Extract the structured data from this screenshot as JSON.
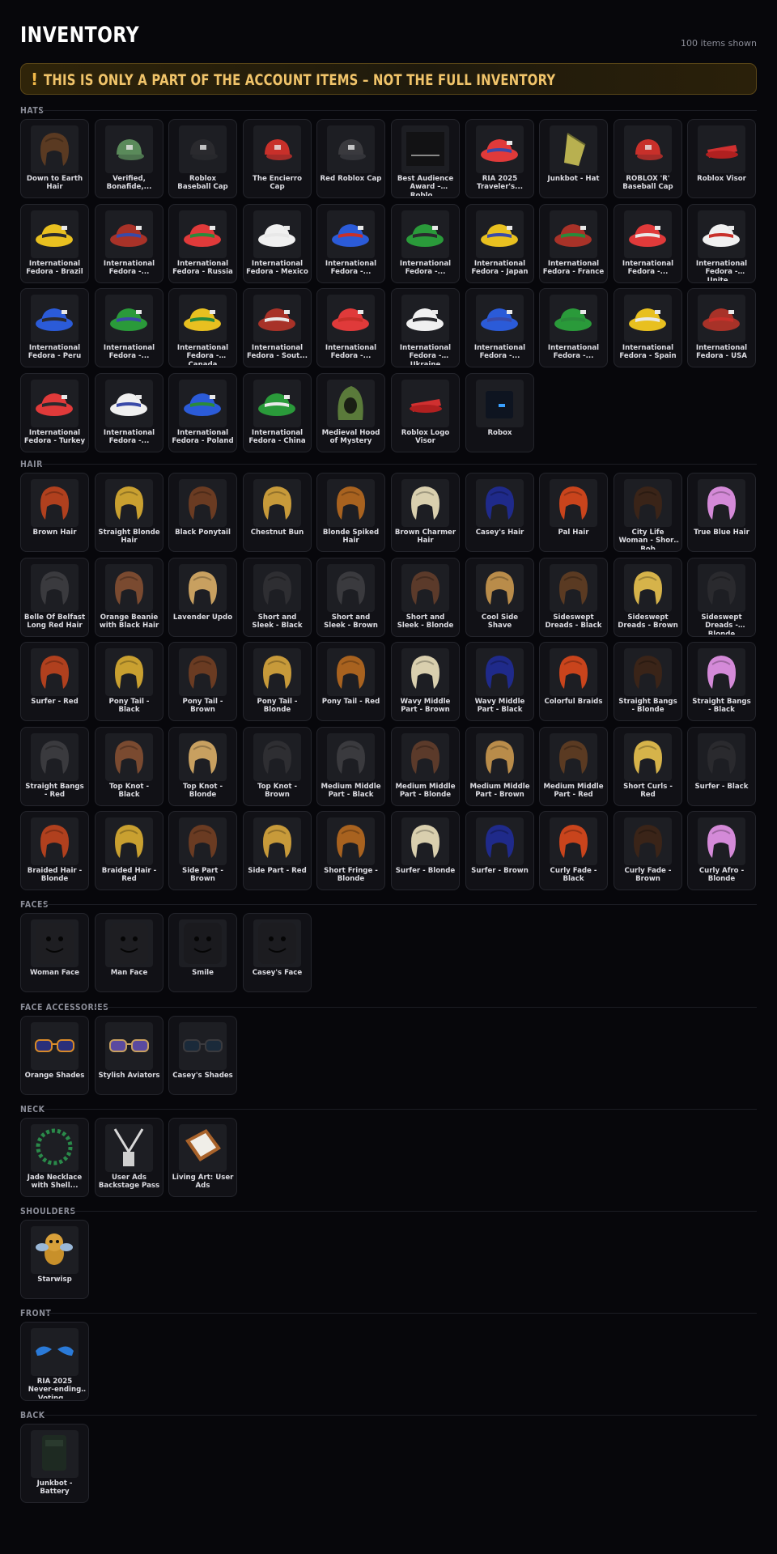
{
  "page": {
    "title": "INVENTORY",
    "count": "100 items shown"
  },
  "warning": {
    "icon": "!",
    "text": "THIS IS ONLY A PART OF THE ACCOUNT ITEMS – NOT THE FULL INVENTORY"
  },
  "colors": {
    "accent": "#f1c46a",
    "background": "#07070b",
    "card": "#111116"
  },
  "sections": [
    {
      "name": "HATS",
      "items": [
        {
          "label": "Down to Earth Hair",
          "icon": "hair-icon"
        },
        {
          "label": "Verified, Bonafide,...",
          "icon": "cap-icon"
        },
        {
          "label": "Roblox Baseball Cap",
          "icon": "cap-icon"
        },
        {
          "label": "The Encierro Cap",
          "icon": "cap-icon"
        },
        {
          "label": "Red Roblox Cap",
          "icon": "cap-icon"
        },
        {
          "label": "Best Audience Award – Roblo...",
          "icon": "award-icon"
        },
        {
          "label": "RIA 2025 Traveler's...",
          "icon": "fedora-icon"
        },
        {
          "label": "Junkbot - Hat",
          "icon": "hat-icon"
        },
        {
          "label": "ROBLOX 'R' Baseball Cap",
          "icon": "cap-icon"
        },
        {
          "label": "Roblox Visor",
          "icon": "visor-icon"
        },
        {
          "label": "International Fedora - Brazil",
          "icon": "fedora-icon"
        },
        {
          "label": "International Fedora -...",
          "icon": "fedora-icon"
        },
        {
          "label": "International Fedora - Russia",
          "icon": "fedora-icon"
        },
        {
          "label": "International Fedora - Mexico",
          "icon": "fedora-icon"
        },
        {
          "label": "International Fedora -...",
          "icon": "fedora-icon"
        },
        {
          "label": "International Fedora -...",
          "icon": "fedora-icon"
        },
        {
          "label": "International Fedora - Japan",
          "icon": "fedora-icon"
        },
        {
          "label": "International Fedora - France",
          "icon": "fedora-icon"
        },
        {
          "label": "International Fedora -...",
          "icon": "fedora-icon"
        },
        {
          "label": "International Fedora - Unite...",
          "icon": "fedora-icon"
        },
        {
          "label": "International Fedora - Peru",
          "icon": "fedora-icon"
        },
        {
          "label": "International Fedora -...",
          "icon": "fedora-icon"
        },
        {
          "label": "International Fedora - Canada",
          "icon": "fedora-icon"
        },
        {
          "label": "International Fedora - Sout...",
          "icon": "fedora-icon"
        },
        {
          "label": "International Fedora -...",
          "icon": "fedora-icon"
        },
        {
          "label": "International Fedora - Ukraine",
          "icon": "fedora-icon"
        },
        {
          "label": "International Fedora -...",
          "icon": "fedora-icon"
        },
        {
          "label": "International Fedora -...",
          "icon": "fedora-icon"
        },
        {
          "label": "International Fedora - Spain",
          "icon": "fedora-icon"
        },
        {
          "label": "International Fedora - USA",
          "icon": "fedora-icon"
        },
        {
          "label": "International Fedora - Turkey",
          "icon": "fedora-icon"
        },
        {
          "label": "International Fedora -...",
          "icon": "fedora-icon"
        },
        {
          "label": "International Fedora - Poland",
          "icon": "fedora-icon"
        },
        {
          "label": "International Fedora - China",
          "icon": "fedora-icon"
        },
        {
          "label": "Medieval Hood of Mystery",
          "icon": "hood-icon"
        },
        {
          "label": "Roblox Logo Visor",
          "icon": "visor-icon"
        },
        {
          "label": "Robox",
          "icon": "box-icon"
        }
      ]
    },
    {
      "name": "HAIR",
      "items": [
        {
          "label": "Brown Hair",
          "icon": "hair-icon"
        },
        {
          "label": "Straight Blonde Hair",
          "icon": "hair-icon"
        },
        {
          "label": "Black Ponytail",
          "icon": "hair-icon"
        },
        {
          "label": "Chestnut Bun",
          "icon": "hair-icon"
        },
        {
          "label": "Blonde Spiked Hair",
          "icon": "hair-icon"
        },
        {
          "label": "Brown Charmer Hair",
          "icon": "hair-icon"
        },
        {
          "label": "Casey's Hair",
          "icon": "hair-icon"
        },
        {
          "label": "Pal Hair",
          "icon": "hair-icon"
        },
        {
          "label": "City Life Woman - Short Bob",
          "icon": "hair-icon"
        },
        {
          "label": "True Blue Hair",
          "icon": "hair-icon"
        },
        {
          "label": "Belle Of Belfast Long Red Hair",
          "icon": "hair-icon"
        },
        {
          "label": "Orange Beanie with Black Hair",
          "icon": "hair-icon"
        },
        {
          "label": "Lavender Updo",
          "icon": "hair-icon"
        },
        {
          "label": "Short and Sleek - Black",
          "icon": "hair-icon"
        },
        {
          "label": "Short and Sleek - Brown",
          "icon": "hair-icon"
        },
        {
          "label": "Short and Sleek - Blonde",
          "icon": "hair-icon"
        },
        {
          "label": "Cool Side Shave",
          "icon": "hair-icon"
        },
        {
          "label": "Sideswept Dreads - Black",
          "icon": "hair-icon"
        },
        {
          "label": "Sideswept Dreads - Brown",
          "icon": "hair-icon"
        },
        {
          "label": "Sideswept Dreads - Blonde",
          "icon": "hair-icon"
        },
        {
          "label": "Surfer - Red",
          "icon": "hair-icon"
        },
        {
          "label": "Pony Tail - Black",
          "icon": "hair-icon"
        },
        {
          "label": "Pony Tail - Brown",
          "icon": "hair-icon"
        },
        {
          "label": "Pony Tail - Blonde",
          "icon": "hair-icon"
        },
        {
          "label": "Pony Tail - Red",
          "icon": "hair-icon"
        },
        {
          "label": "Wavy Middle Part - Brown",
          "icon": "hair-icon"
        },
        {
          "label": "Wavy Middle Part - Black",
          "icon": "hair-icon"
        },
        {
          "label": "Colorful Braids",
          "icon": "hair-icon"
        },
        {
          "label": "Straight Bangs - Blonde",
          "icon": "hair-icon"
        },
        {
          "label": "Straight Bangs - Black",
          "icon": "hair-icon"
        },
        {
          "label": "Straight Bangs - Red",
          "icon": "hair-icon"
        },
        {
          "label": "Top Knot - Black",
          "icon": "hair-icon"
        },
        {
          "label": "Top Knot - Blonde",
          "icon": "hair-icon"
        },
        {
          "label": "Top Knot - Brown",
          "icon": "hair-icon"
        },
        {
          "label": "Medium Middle Part - Black",
          "icon": "hair-icon"
        },
        {
          "label": "Medium Middle Part - Blonde",
          "icon": "hair-icon"
        },
        {
          "label": "Medium Middle Part - Brown",
          "icon": "hair-icon"
        },
        {
          "label": "Medium Middle Part - Red",
          "icon": "hair-icon"
        },
        {
          "label": "Short Curls - Red",
          "icon": "hair-icon"
        },
        {
          "label": "Surfer - Black",
          "icon": "hair-icon"
        },
        {
          "label": "Braided Hair - Blonde",
          "icon": "hair-icon"
        },
        {
          "label": "Braided Hair - Red",
          "icon": "hair-icon"
        },
        {
          "label": "Side Part - Brown",
          "icon": "hair-icon"
        },
        {
          "label": "Side Part - Red",
          "icon": "hair-icon"
        },
        {
          "label": "Short Fringe - Blonde",
          "icon": "hair-icon"
        },
        {
          "label": "Surfer - Blonde",
          "icon": "hair-icon"
        },
        {
          "label": "Surfer - Brown",
          "icon": "hair-icon"
        },
        {
          "label": "Curly Fade - Black",
          "icon": "hair-icon"
        },
        {
          "label": "Curly Fade - Brown",
          "icon": "hair-icon"
        },
        {
          "label": "Curly Afro - Blonde",
          "icon": "hair-icon"
        }
      ]
    },
    {
      "name": "FACES",
      "items": [
        {
          "label": "Woman Face",
          "icon": "face-icon"
        },
        {
          "label": "Man Face",
          "icon": "face-icon"
        },
        {
          "label": "Smile",
          "icon": "face-icon"
        },
        {
          "label": "Casey's Face",
          "icon": "face-icon"
        }
      ]
    },
    {
      "name": "FACE ACCESSORIES",
      "items": [
        {
          "label": "Orange Shades",
          "icon": "sunglasses-icon"
        },
        {
          "label": "Stylish Aviators",
          "icon": "sunglasses-icon"
        },
        {
          "label": "Casey's Shades",
          "icon": "sunglasses-icon"
        }
      ]
    },
    {
      "name": "NECK",
      "items": [
        {
          "label": "Jade Necklace with Shell...",
          "icon": "necklace-icon"
        },
        {
          "label": "User Ads Backstage Pass",
          "icon": "lanyard-icon"
        },
        {
          "label": "Living Art: User Ads",
          "icon": "frame-icon"
        }
      ]
    },
    {
      "name": "SHOULDERS",
      "items": [
        {
          "label": "Starwisp",
          "icon": "creature-icon"
        }
      ]
    },
    {
      "name": "FRONT",
      "items": [
        {
          "label": "RIA 2025 Never-ending Voting...",
          "icon": "wings-icon"
        }
      ]
    },
    {
      "name": "BACK",
      "items": [
        {
          "label": "Junkbot - Battery",
          "icon": "battery-icon"
        }
      ]
    }
  ]
}
